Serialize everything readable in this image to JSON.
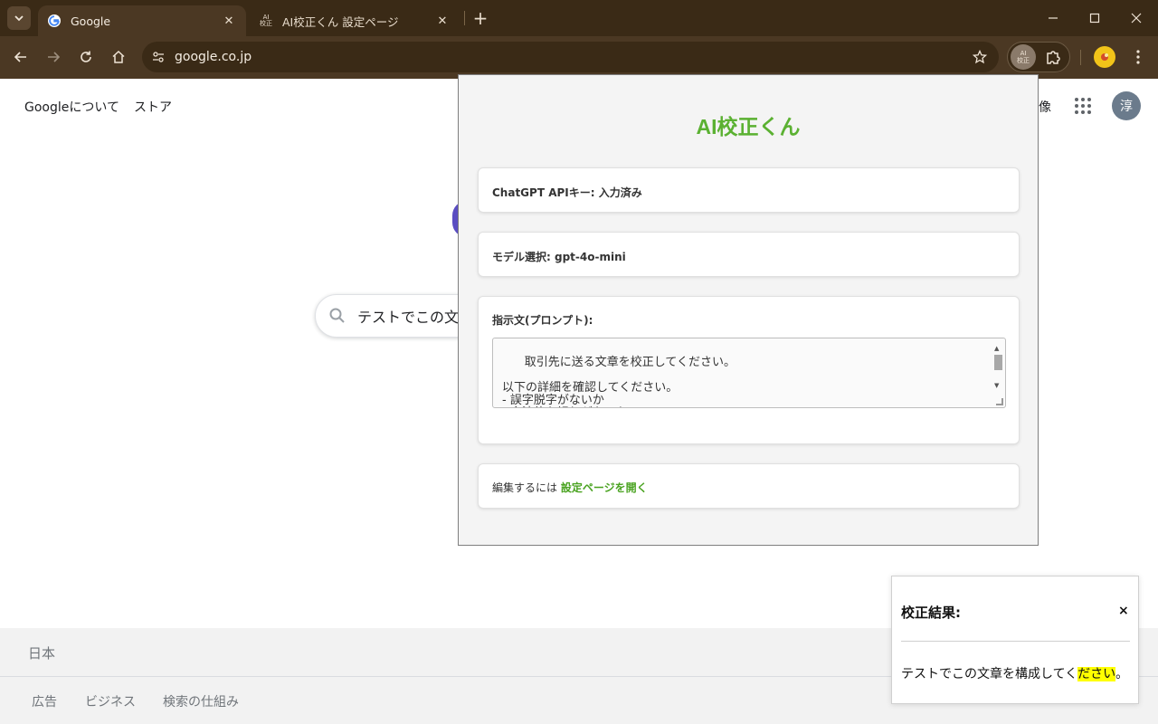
{
  "browser": {
    "tabs": [
      {
        "title": "Google",
        "active": true
      },
      {
        "title": "AI校正くん 設定ページ",
        "active": false,
        "favicon_text": "AI\n校正"
      }
    ],
    "url": "google.co.jp",
    "extension_badge": "AI\n校正"
  },
  "google": {
    "top_links": [
      "Googleについて",
      "ストア"
    ],
    "right_link": "像",
    "avatar_letter": "淳",
    "search_query": "テストでこの文",
    "footer_country": "日本",
    "footer_links": [
      "広告",
      "ビジネス",
      "検索の仕組み"
    ]
  },
  "popup": {
    "title": "AI校正くん",
    "api_key": "ChatGPT APIキー: 入力済み",
    "model": "モデル選択: gpt-4o-mini",
    "prompt_label": "指示文(プロンプト):",
    "prompt_text": "取引先に送る文章を校正してください。\n\n以下の詳細を確認してください。\n- 誤字脱字がないか\n- 文法的な誤りがないか",
    "edit_prefix": "編集するには ",
    "edit_link": "設定ページを開く",
    "accent_color": "#5bb132"
  },
  "result": {
    "title": "校正結果:",
    "close": "×",
    "text_before": "テストでこの文章を構成してく",
    "text_highlight": "ださい",
    "text_after": "。",
    "highlight_color": "#ffff00"
  }
}
